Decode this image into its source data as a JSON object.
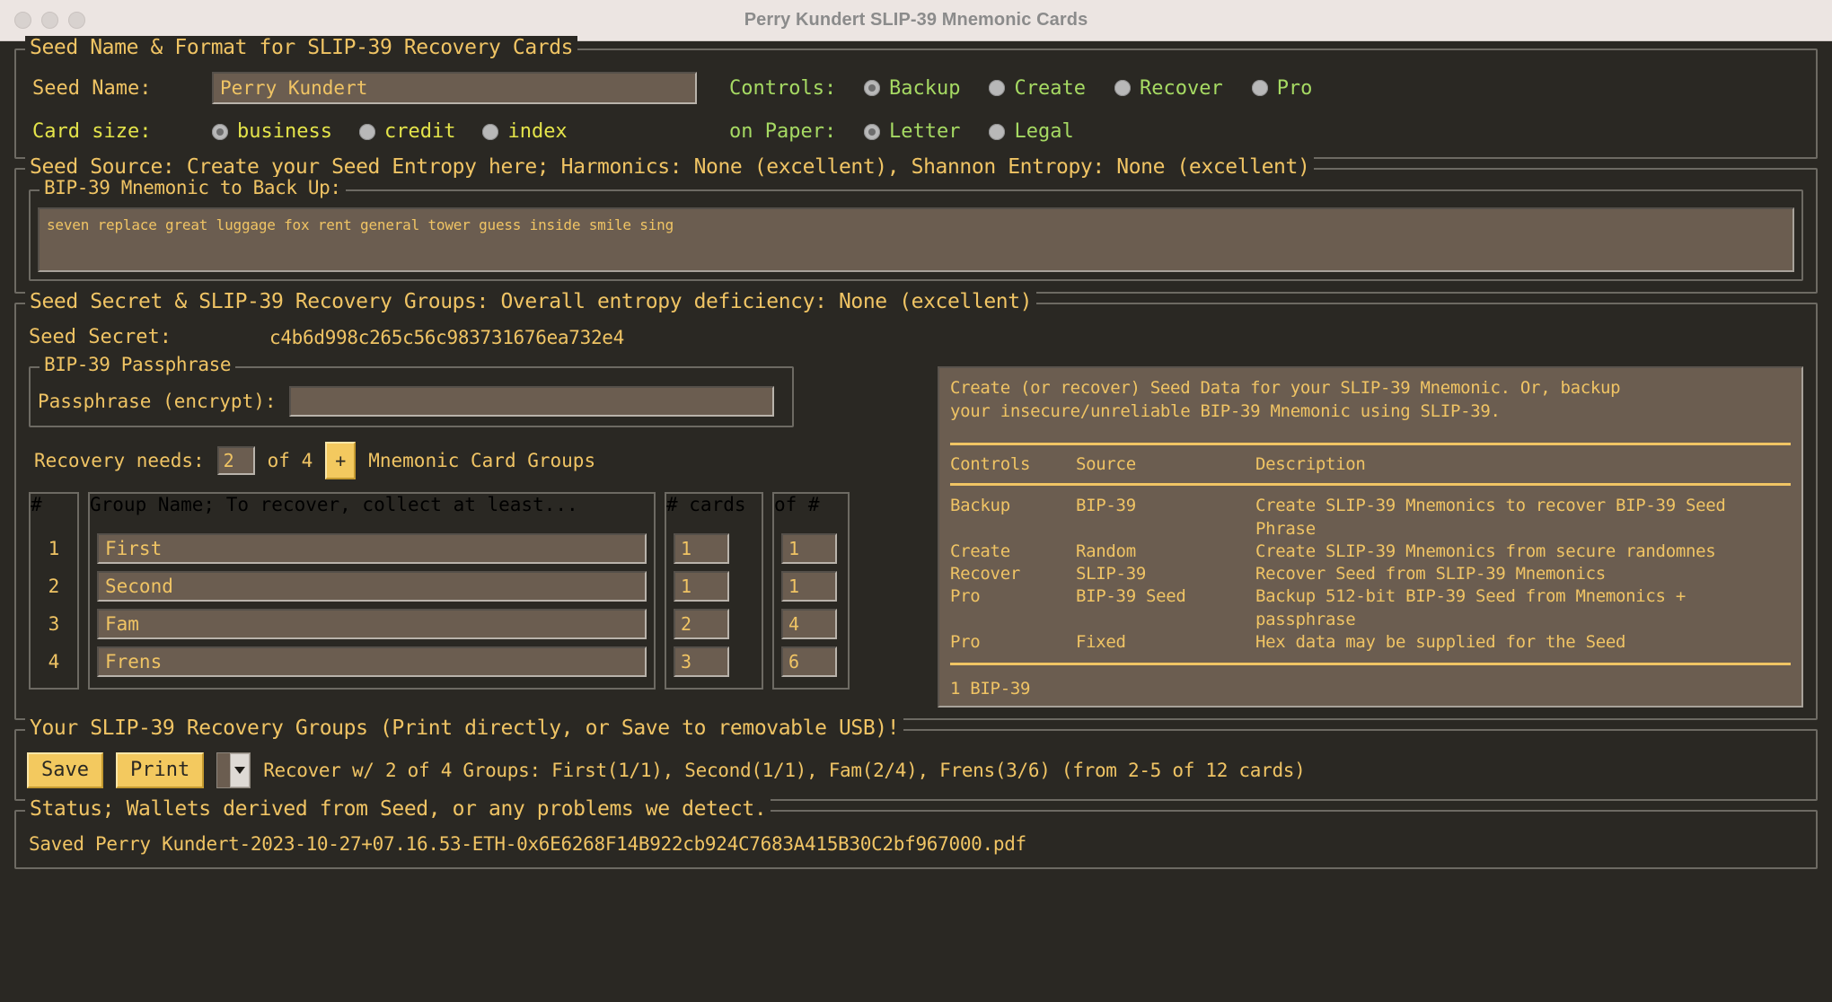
{
  "window": {
    "title": "Perry Kundert SLIP-39 Mnemonic Cards",
    "accent_gold": "#f0c464",
    "accent_green": "#a6da63",
    "accent_yellow": "#e4e44a",
    "background": "#2a2823",
    "field_background": "#6b5d50",
    "button_background": "#f3c95f"
  },
  "seed_name_section": {
    "legend": "Seed Name & Format for SLIP-39 Recovery Cards",
    "seed_name_label": "Seed Name:",
    "seed_name_value": "Perry Kundert",
    "card_size_label": "Card size:",
    "card_sizes": [
      {
        "label": "business",
        "selected": true
      },
      {
        "label": "credit",
        "selected": false
      },
      {
        "label": "index",
        "selected": false
      }
    ],
    "controls_label": "Controls:",
    "controls": [
      {
        "label": "Backup",
        "selected": true
      },
      {
        "label": "Create",
        "selected": false
      },
      {
        "label": "Recover",
        "selected": false
      },
      {
        "label": "Pro",
        "selected": false
      }
    ],
    "paper_label": "on Paper:",
    "papers": [
      {
        "label": "Letter",
        "selected": true
      },
      {
        "label": "Legal",
        "selected": false
      }
    ]
  },
  "seed_source_section": {
    "legend": "Seed Source: Create your Seed Entropy here; Harmonics: None (excellent), Shannon Entropy: None (excellent)",
    "mnemonic_legend": "BIP-39 Mnemonic to Back Up:",
    "mnemonic_value": "seven replace great luggage fox rent general tower guess inside smile sing"
  },
  "seed_secret_section": {
    "legend": "Seed Secret & SLIP-39 Recovery Groups: Overall entropy deficiency: None (excellent)",
    "seed_secret_label": "Seed Secret:",
    "seed_secret_value": "c4b6d998c265c56c983731676ea732e4",
    "passphrase_legend": "BIP-39 Passphrase",
    "passphrase_label": "Passphrase (encrypt):",
    "passphrase_value": "",
    "recovery_needs_label": "Recovery needs:",
    "recovery_threshold": "2",
    "recovery_of_label": "of 4",
    "add_group_label": "+",
    "recovery_groups_suffix": "Mnemonic Card Groups",
    "table": {
      "col_index_legend": "#",
      "col_name_legend": "Group Name; To recover, collect at least...",
      "col_cards_legend": "# cards",
      "col_of_legend": "of #",
      "rows": [
        {
          "index": "1",
          "name": "First",
          "cards": "1",
          "of": "1"
        },
        {
          "index": "2",
          "name": "Second",
          "cards": "1",
          "of": "1"
        },
        {
          "index": "3",
          "name": "Fam",
          "cards": "2",
          "of": "4"
        },
        {
          "index": "4",
          "name": "Frens",
          "cards": "3",
          "of": "6"
        }
      ]
    }
  },
  "info_panel": {
    "paragraph_line1": "Create (or recover) Seed Data for your SLIP-39 Mnemonic.  Or, backup",
    "paragraph_line2": "your insecure/unreliable BIP-39 Mnemonic using SLIP-39.",
    "headers": {
      "controls": "Controls",
      "source": "Source",
      "description": "Description"
    },
    "rows": [
      {
        "controls": "Backup",
        "source": "BIP-39",
        "description": "Create SLIP-39 Mnemonics to recover BIP-39 Seed Phrase"
      },
      {
        "controls": "Create",
        "source": "Random",
        "description": "Create SLIP-39 Mnemonics from secure randomnes"
      },
      {
        "controls": "Recover",
        "source": "SLIP-39",
        "description": "Recover Seed from SLIP-39 Mnemonics"
      },
      {
        "controls": "Pro",
        "source": "BIP-39 Seed",
        "description": "Backup 512-bit BIP-39 Seed from Mnemonics + passphrase"
      },
      {
        "controls": "Pro",
        "source": "Fixed",
        "description": "Hex data may be supplied for the Seed"
      }
    ],
    "footer": "1 BIP-39"
  },
  "output_section": {
    "legend": "Your SLIP-39 Recovery Groups (Print directly, or Save to removable USB)!",
    "save_label": "Save",
    "print_label": "Print",
    "format_selected": "",
    "recovery_summary": "Recover w/ 2 of 4 Groups: First(1/1), Second(1/1), Fam(2/4), Frens(3/6) (from 2-5 of 12 cards)"
  },
  "status_section": {
    "legend": "Status; Wallets derived from Seed, or any problems we detect.",
    "message": "Saved Perry Kundert-2023-10-27+07.16.53-ETH-0x6E6268F14B922cb924C7683A415B30C2bf967000.pdf"
  }
}
